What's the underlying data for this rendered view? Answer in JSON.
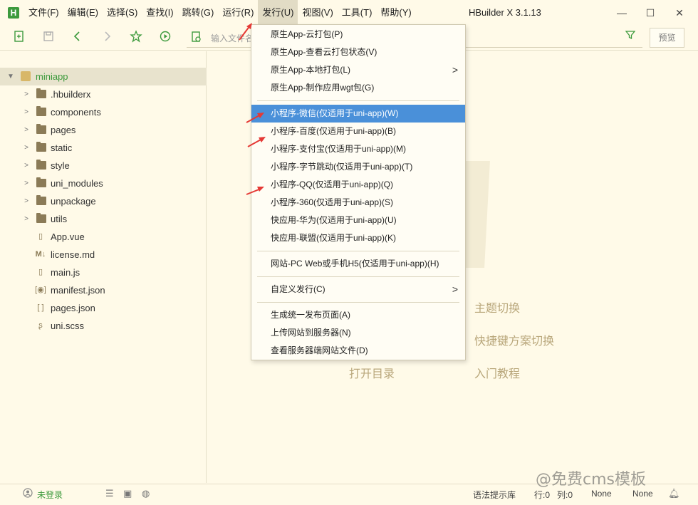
{
  "app": {
    "logo_letter": "H",
    "window_title": "HBuilder X 3.1.13"
  },
  "menu": [
    {
      "label": "文件(F)"
    },
    {
      "label": "编辑(E)"
    },
    {
      "label": "选择(S)"
    },
    {
      "label": "查找(I)"
    },
    {
      "label": "跳转(G)"
    },
    {
      "label": "运行(R)"
    },
    {
      "label": "发行(U)",
      "active": true
    },
    {
      "label": "视图(V)"
    },
    {
      "label": "工具(T)"
    },
    {
      "label": "帮助(Y)"
    }
  ],
  "window_controls": {
    "minimize": "—",
    "maximize": "☐",
    "close": "✕"
  },
  "toolbar": {
    "search_placeholder": "输入文件名",
    "preview_label": "预览"
  },
  "sidebar": {
    "project": {
      "label": "miniapp",
      "expanded": true
    },
    "items": [
      {
        "label": ".hbuilderx",
        "type": "folder"
      },
      {
        "label": "components",
        "type": "folder"
      },
      {
        "label": "pages",
        "type": "folder"
      },
      {
        "label": "static",
        "type": "folder"
      },
      {
        "label": "style",
        "type": "folder"
      },
      {
        "label": "uni_modules",
        "type": "folder"
      },
      {
        "label": "unpackage",
        "type": "folder"
      },
      {
        "label": "utils",
        "type": "folder"
      },
      {
        "label": "App.vue",
        "type": "vue-file"
      },
      {
        "label": "license.md",
        "type": "md-file"
      },
      {
        "label": "main.js",
        "type": "js-file"
      },
      {
        "label": "manifest.json",
        "type": "manifest-file"
      },
      {
        "label": "pages.json",
        "type": "json-file"
      },
      {
        "label": "uni.scss",
        "type": "scss-file"
      }
    ]
  },
  "publish_menu": {
    "groups": [
      [
        {
          "label": "原生App-云打包(P)"
        },
        {
          "label": "原生App-查看云打包状态(V)"
        },
        {
          "label": "原生App-本地打包(L)",
          "submenu": true
        },
        {
          "label": "原生App-制作应用wgt包(G)"
        }
      ],
      [
        {
          "label": "小程序-微信(仅适用于uni-app)(W)",
          "highlighted": true
        },
        {
          "label": "小程序-百度(仅适用于uni-app)(B)"
        },
        {
          "label": "小程序-支付宝(仅适用于uni-app)(M)"
        },
        {
          "label": "小程序-字节跳动(仅适用于uni-app)(T)"
        },
        {
          "label": "小程序-QQ(仅适用于uni-app)(Q)"
        },
        {
          "label": "小程序-360(仅适用于uni-app)(S)"
        },
        {
          "label": "快应用-华为(仅适用于uni-app)(U)"
        },
        {
          "label": "快应用-联盟(仅适用于uni-app)(K)"
        }
      ],
      [
        {
          "label": "网站-PC Web或手机H5(仅适用于uni-app)(H)"
        }
      ],
      [
        {
          "label": "自定义发行(C)",
          "submenu": true
        }
      ],
      [
        {
          "label": "生成统一发布页面(A)"
        },
        {
          "label": "上传网站到服务器(N)"
        },
        {
          "label": "查看服务器端网站文件(D)"
        }
      ]
    ]
  },
  "welcome": {
    "theme_switch": "主题切换",
    "keymap_switch": "快捷键方案切换",
    "open_directory": "打开目录",
    "tutorial": "入门教程"
  },
  "statusbar": {
    "login": "未登录",
    "syntax_hint": "语法提示库",
    "line": "行:0",
    "column": "列:0",
    "encoding": "None",
    "eol": "None"
  },
  "watermark_text": "@免费cms模板",
  "colors": {
    "accent_green": "#3c9a3c",
    "menu_highlight": "#4a90d9",
    "background": "#fffae8",
    "annotation_red": "#e53935"
  }
}
